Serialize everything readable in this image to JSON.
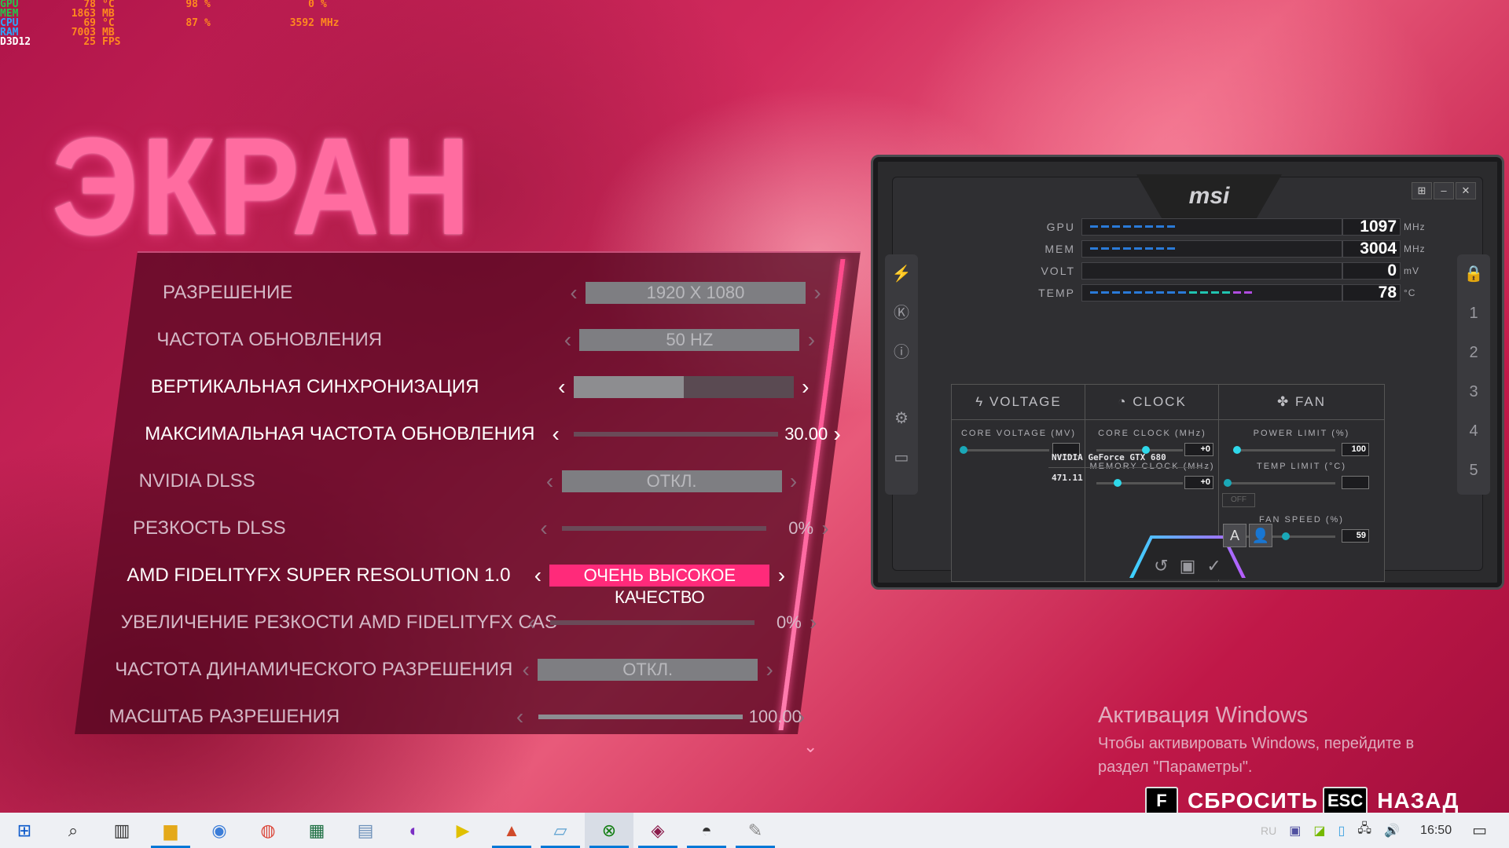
{
  "osd": [
    {
      "label": "GPU",
      "color": "#22c84a",
      "v1": "78",
      "u1": "°C",
      "v2": "98",
      "u2": "%",
      "v3": "0",
      "u3": "%"
    },
    {
      "label": "MEM",
      "color": "#22c84a",
      "v1": "1863",
      "u1": "MB",
      "v2": "",
      "u2": "",
      "v3": "",
      "u3": ""
    },
    {
      "label": "CPU",
      "color": "#2aa8ff",
      "v1": "69",
      "u1": "°C",
      "v2": "87",
      "u2": "%",
      "v3": "3592",
      "u3": "MHz"
    },
    {
      "label": "RAM",
      "color": "#2aa8ff",
      "v1": "7003",
      "u1": "MB",
      "v2": "",
      "u2": "",
      "v3": "",
      "u3": ""
    },
    {
      "label": "D3D12",
      "color": "#ffffff",
      "v1": "25",
      "u1": "FPS",
      "v2": "",
      "u2": "",
      "v3": "",
      "u3": ""
    }
  ],
  "title": "ЭКРАН",
  "settings": [
    {
      "label": "Разрешение",
      "type": "box",
      "value": "1920 X 1080"
    },
    {
      "label": "Частота обновления",
      "type": "box",
      "value": "50 HZ"
    },
    {
      "label": "Вертикальная синхронизация",
      "type": "half",
      "value": ""
    },
    {
      "label": "Максимальная частота обновления",
      "type": "slider",
      "value": "30.00",
      "fill": 0
    },
    {
      "label": "NVIDIA DLSS",
      "type": "box",
      "value": "ОТКЛ."
    },
    {
      "label": "Резкость DLSS",
      "type": "slider",
      "value": "0%",
      "fill": 0
    },
    {
      "label": "AMD FidelityFX Super Resolution 1.0",
      "type": "pink",
      "value": "ОЧЕНЬ ВЫСОКОЕ КАЧЕСТВО"
    },
    {
      "label": "Увеличение резкости AMD FidelityFX CAS",
      "type": "slider",
      "value": "0%",
      "fill": 0
    },
    {
      "label": "Частота динамического разрешения",
      "type": "box",
      "value": "ОТКЛ."
    },
    {
      "label": "Масштаб разрешения",
      "type": "slider",
      "value": "100.00",
      "fill": 1
    }
  ],
  "msi": {
    "logo": "msi",
    "monitors": [
      {
        "label": "GPU",
        "value": "1097",
        "unit": "MHz",
        "level": 0.35
      },
      {
        "label": "MEM",
        "value": "3004",
        "unit": "MHz",
        "level": 0.33
      },
      {
        "label": "VOLT",
        "value": "0",
        "unit": "mV",
        "level": 0
      },
      {
        "label": "TEMP",
        "value": "78",
        "unit": "°C",
        "level": 0.64
      }
    ],
    "sections": {
      "voltage": {
        "title": "VOLTAGE",
        "core_voltage": "CORE VOLTAGE (MV)"
      },
      "clock": {
        "title": "CLOCK",
        "core_clock": "CORE CLOCK (MHz)",
        "core_val": "+0",
        "mem_clock": "MEMORY CLOCK (MHz)",
        "mem_val": "+0"
      },
      "fan": {
        "title": "FAN",
        "power_limit": "POWER LIMIT (%)",
        "power_val": "100",
        "temp_limit": "TEMP LIMIT (°C)",
        "off": "OFF",
        "fan_speed": "FAN SPEED (%)",
        "fan_val": "59"
      }
    },
    "gpu_name": "NVIDIA GeForce GTX 680",
    "driver": "471.11",
    "side_right": [
      "1",
      "2",
      "3",
      "4",
      "5"
    ]
  },
  "activation": {
    "title": "Активация Windows",
    "text": "Чтобы активировать Windows, перейдите в раздел \"Параметры\"."
  },
  "prompts": [
    {
      "key": "F",
      "label": "СБРОСИТЬ"
    },
    {
      "key": "ESC",
      "label": "НАЗАД"
    }
  ],
  "taskbar": {
    "lang": "RU",
    "time": "16:50"
  }
}
